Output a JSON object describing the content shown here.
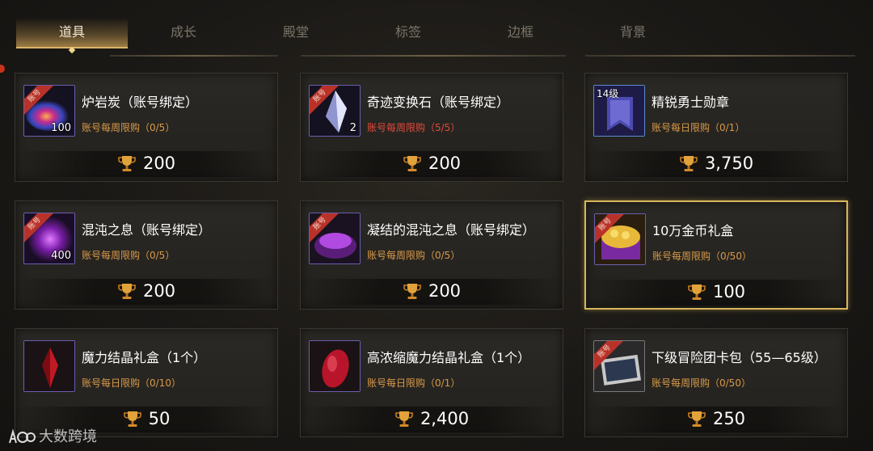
{
  "tabs": [
    {
      "label": "道具",
      "active": true
    },
    {
      "label": "成长",
      "active": false
    },
    {
      "label": "殿堂",
      "active": false
    },
    {
      "label": "标签",
      "active": false
    },
    {
      "label": "边框",
      "active": false
    },
    {
      "label": "背景",
      "active": false
    }
  ],
  "items": [
    {
      "name": "炉岩炭（账号绑定）",
      "limit": "账号每周限购（0/5）",
      "price": "200",
      "qty": "100",
      "ribbon": "账号",
      "icon": "lava-charcoal-icon"
    },
    {
      "name": "奇迹变换石（账号绑定）",
      "limit": "账号每周限购（5/5）",
      "limit_full": true,
      "price": "200",
      "qty": "2",
      "ribbon": "账号",
      "icon": "crystal-icon"
    },
    {
      "name": "精锐勇士勋章",
      "limit": "账号每日限购（0/1）",
      "price": "3,750",
      "level": "14级",
      "icon": "banner-icon"
    },
    {
      "name": "混沌之息（账号绑定）",
      "limit": "账号每周限购（0/5）",
      "price": "200",
      "qty": "400",
      "ribbon": "账号",
      "icon": "chaos-orb-icon"
    },
    {
      "name": "凝结的混沌之息（账号绑定）",
      "limit": "账号每周限购（0/5）",
      "price": "200",
      "ribbon": "账号",
      "icon": "chaos-bowl-icon"
    },
    {
      "name": "10万金币礼盒",
      "limit": "账号每周限购（0/50）",
      "price": "100",
      "ribbon": "账号",
      "icon": "gold-chest-icon",
      "selected": true
    },
    {
      "name": "魔力结晶礼盒（1个）",
      "limit": "账号每日限购（0/10）",
      "price": "50",
      "icon": "red-crystal-icon"
    },
    {
      "name": "高浓缩魔力结晶礼盒（1个）",
      "limit": "账号每日限购（0/1）",
      "price": "2,400",
      "icon": "red-gem-icon"
    },
    {
      "name": "下级冒险团卡包（55—65级）",
      "limit": "账号每周限购（0/50）",
      "price": "250",
      "ribbon": "账号",
      "icon": "card-pack-icon"
    }
  ],
  "watermark": "大数跨境",
  "colors": {
    "accent": "#d8b65a",
    "limit": "#d99a4a",
    "limit_full": "#e14a3a",
    "ribbon": "#b8322a"
  }
}
